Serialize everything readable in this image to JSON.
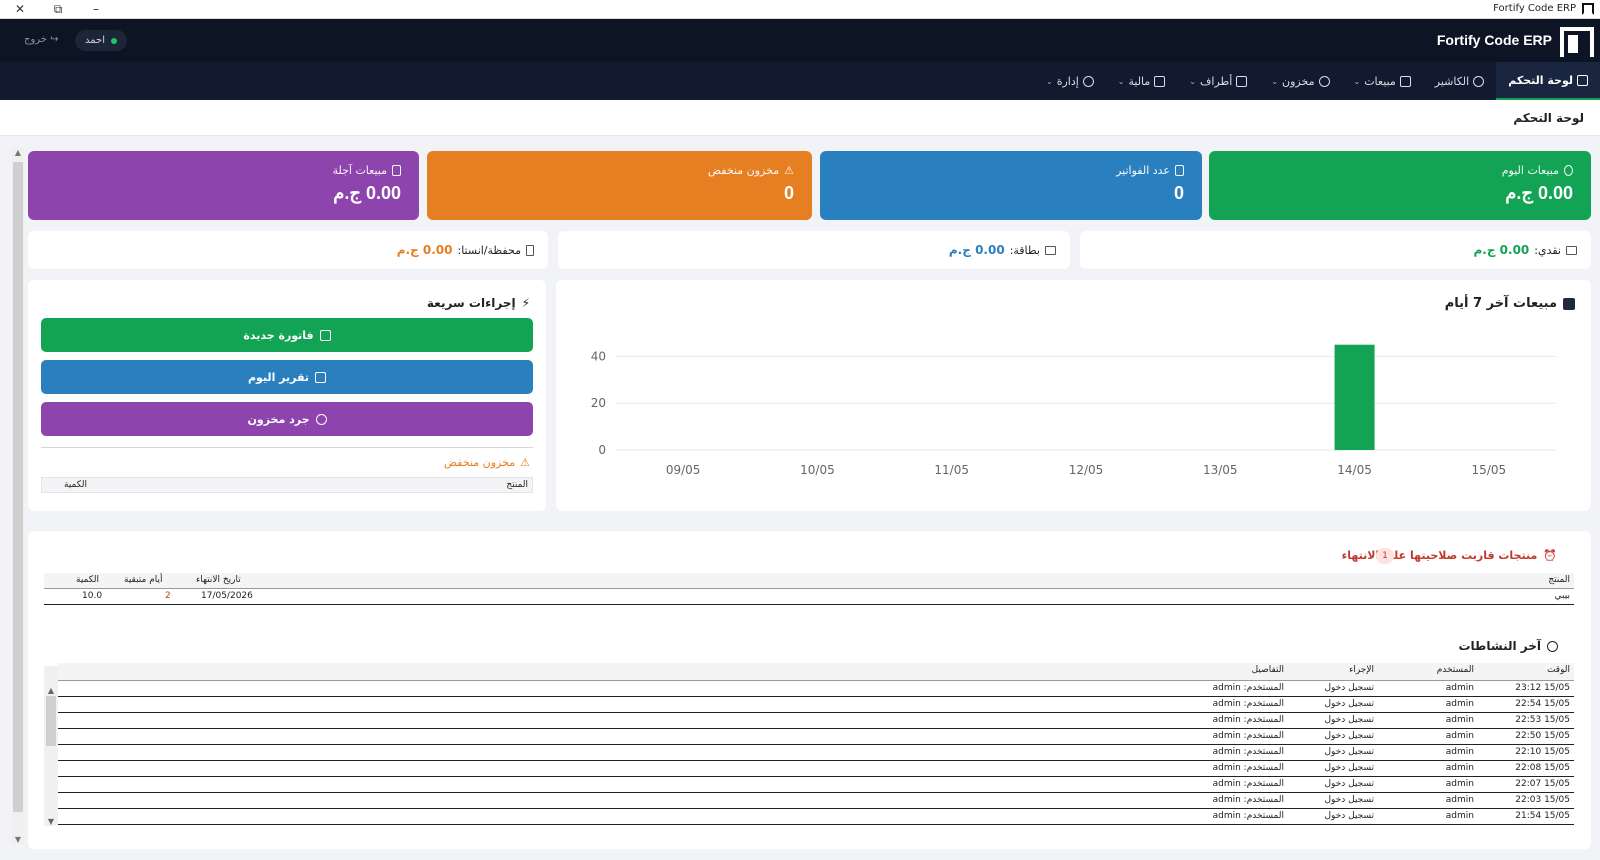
{
  "window": {
    "title": "Fortify Code ERP"
  },
  "header": {
    "brand": "Fortify Code ERP",
    "user": "احمد",
    "logout": "خروج"
  },
  "nav": [
    {
      "label": "لوحة التحكم",
      "active": true,
      "caret": false
    },
    {
      "label": "الكاشير",
      "active": false,
      "caret": false
    },
    {
      "label": "مبيعات",
      "active": false,
      "caret": true
    },
    {
      "label": "مخزون",
      "active": false,
      "caret": true
    },
    {
      "label": "أطراف",
      "active": false,
      "caret": true
    },
    {
      "label": "مالية",
      "active": false,
      "caret": true
    },
    {
      "label": "إدارة",
      "active": false,
      "caret": true
    }
  ],
  "page_title": "لوحة التحكم",
  "stats": {
    "today_sales": {
      "label": "مبيعات اليوم",
      "value": "0.00 ج.م",
      "color": "#12a454"
    },
    "invoices": {
      "label": "عدد الفواتير",
      "value": "0",
      "color": "#2a80bf"
    },
    "low_stock": {
      "label": "مخزون منخفض",
      "value": "0",
      "color": "#e67e22"
    },
    "credit_sales": {
      "label": "مبيعات آجلة",
      "value": "0.00 ج.م",
      "color": "#8e44ad"
    }
  },
  "payments": {
    "cash": {
      "label": "نقدي:",
      "amount": "0.00 ج.م",
      "color": "#12a454"
    },
    "card": {
      "label": "بطاقة:",
      "amount": "0.00 ج.م",
      "color": "#2a80bf"
    },
    "wallet": {
      "label": "محفظة/انستا:",
      "amount": "0.00 ج.م",
      "color": "#e67e22"
    }
  },
  "chart_data": {
    "type": "bar",
    "title": "مبيعات آخر 7 أيام",
    "categories": [
      "09/05",
      "10/05",
      "11/05",
      "12/05",
      "13/05",
      "14/05",
      "15/05"
    ],
    "values": [
      0,
      0,
      0,
      0,
      0,
      45,
      0
    ],
    "yticks": [
      0,
      20,
      40
    ],
    "ylim": [
      0,
      50
    ],
    "grid": true,
    "color": "#12a454"
  },
  "quick_actions": {
    "title": "إجراءات سريعة",
    "new_invoice": "فاتورة جديدة",
    "today_report": "تقرير اليوم",
    "stock_count": "جرد مخزون",
    "low_stock_title": "مخزون منخفض",
    "col_product": "المنتج",
    "col_qty": "الكمية"
  },
  "expiry": {
    "title": "منتجات قاربت صلاحيتها على الانتهاء",
    "count": "1",
    "columns": [
      "المنتج",
      "تاريخ الانتهاء",
      "أيام متبقية",
      "الكمية"
    ],
    "rows": [
      {
        "product": "بيبي",
        "date": "17/05/2026",
        "days": "2",
        "qty": "10.0"
      }
    ]
  },
  "activities": {
    "title": "آخر النشاطات",
    "columns": [
      "الوقت",
      "المستخدم",
      "الإجراء",
      "التفاصيل"
    ],
    "rows": [
      {
        "time": "15/05 23:12",
        "user": "admin",
        "action": "تسجيل دخول",
        "details": "المستخدم: admin"
      },
      {
        "time": "15/05 22:54",
        "user": "admin",
        "action": "تسجيل دخول",
        "details": "المستخدم: admin"
      },
      {
        "time": "15/05 22:53",
        "user": "admin",
        "action": "تسجيل دخول",
        "details": "المستخدم: admin"
      },
      {
        "time": "15/05 22:50",
        "user": "admin",
        "action": "تسجيل دخول",
        "details": "المستخدم: admin"
      },
      {
        "time": "15/05 22:10",
        "user": "admin",
        "action": "تسجيل دخول",
        "details": "المستخدم: admin"
      },
      {
        "time": "15/05 22:08",
        "user": "admin",
        "action": "تسجيل دخول",
        "details": "المستخدم: admin"
      },
      {
        "time": "15/05 22:07",
        "user": "admin",
        "action": "تسجيل دخول",
        "details": "المستخدم: admin"
      },
      {
        "time": "15/05 22:03",
        "user": "admin",
        "action": "تسجيل دخول",
        "details": "المستخدم: admin"
      },
      {
        "time": "15/05 21:54",
        "user": "admin",
        "action": "تسجيل دخول",
        "details": "المستخدم: admin"
      }
    ]
  }
}
